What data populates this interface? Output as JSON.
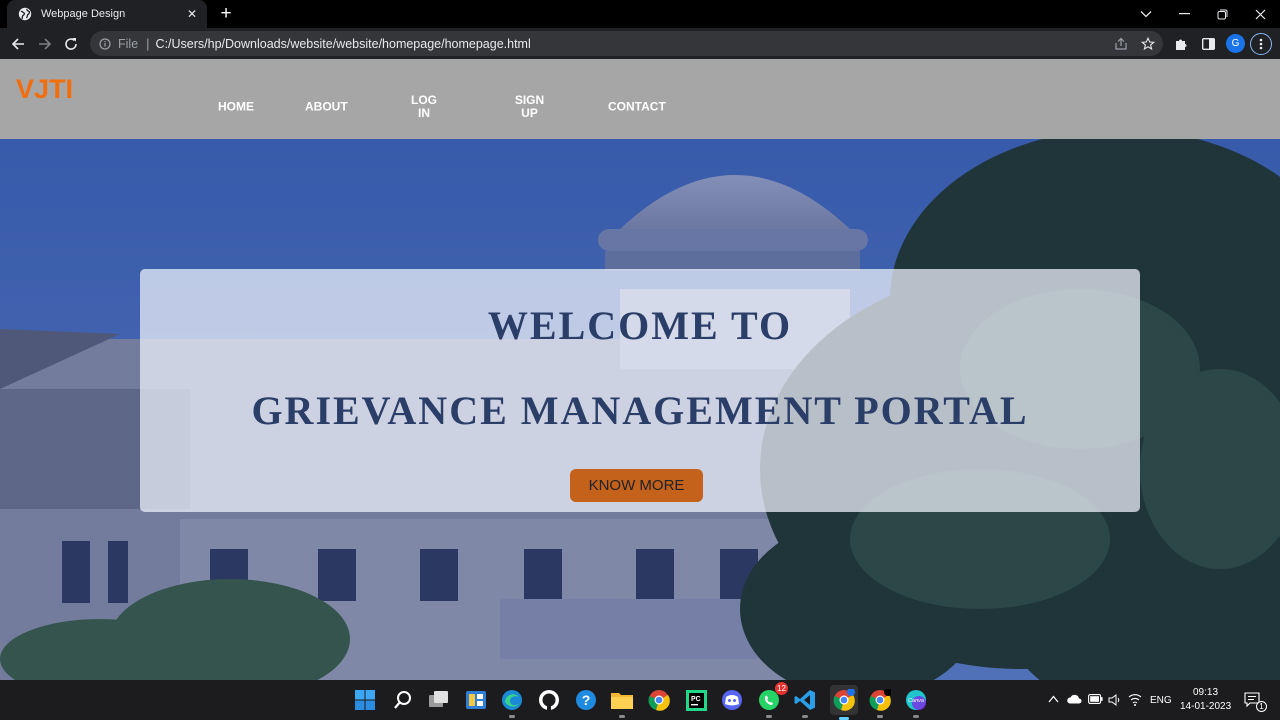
{
  "browser": {
    "tab_title": "Webpage Design",
    "tab_close": "✕",
    "new_tab": "+",
    "file_label": "File",
    "url": "C:/Users/hp/Downloads/website/website/homepage/homepage.html",
    "profile_initial": "G"
  },
  "site": {
    "logo": "VJTI",
    "nav": {
      "home": "HOME",
      "about": "ABOUT",
      "login": "LOG\nIN",
      "signup": "SIGN\nUP",
      "contact": "CONTACT"
    },
    "hero": {
      "heading_1": "WELCOME TO",
      "heading_2": "GRIEVANCE MANAGEMENT PORTAL",
      "cta": "KNOW MORE"
    }
  },
  "taskbar": {
    "whatsapp_badge": "12",
    "language": "ENG",
    "time": "09:13",
    "date": "14-01-2023",
    "notification_count": "1"
  }
}
